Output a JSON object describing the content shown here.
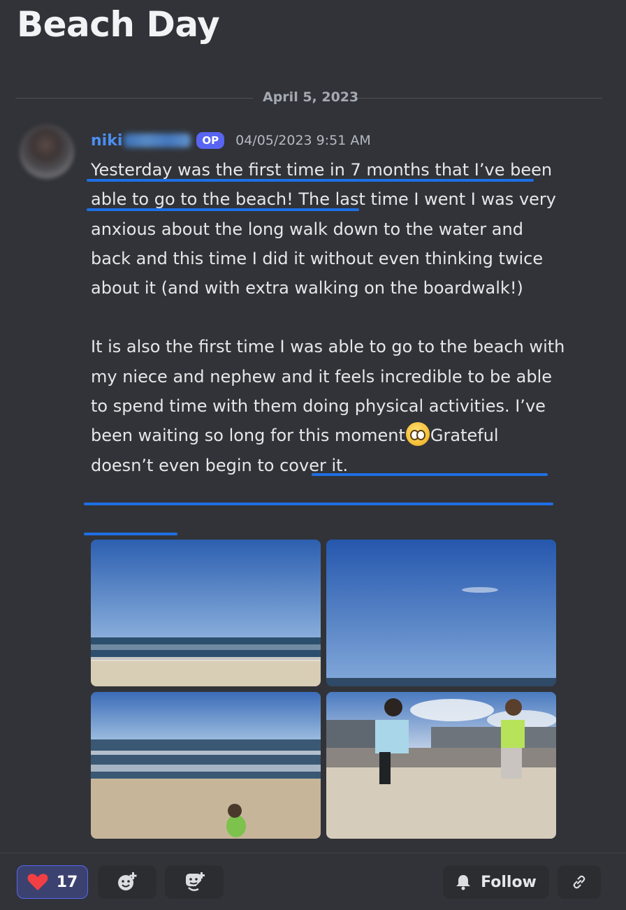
{
  "page_title": "Beach Day",
  "date_divider": "April 5, 2023",
  "post": {
    "author": "niki",
    "op_badge": "OP",
    "timestamp": "04/05/2023 9:51 AM",
    "paragraph1": "Yesterday was the first time in 7 months that I’ve been able to go to the beach! The last time I went I was very anxious about the long walk down to the water and back and this time I did it without even thinking twice about it (and with extra walking on the boardwalk!)",
    "paragraph2_before": "It is also the first time I was able to go to the beach with my niece and nephew and it feels incredible to be able to spend time with them doing physical activities. I’ve been waiting so long for this moment",
    "paragraph2_emoji": "pleading-face-emoji",
    "paragraph2_after": "Grateful doesn’t even begin to cover it.",
    "images": [
      {
        "name": "beach-photo-1"
      },
      {
        "name": "beach-photo-2"
      },
      {
        "name": "beach-photo-3"
      },
      {
        "name": "beach-photo-4"
      }
    ]
  },
  "footer": {
    "reaction_icon": "heart-icon",
    "reaction_count": "17",
    "add_reaction_icon": "add-reaction-icon",
    "sticker_icon": "add-sticker-icon",
    "follow_label": "Follow",
    "follow_icon": "bell-icon",
    "link_icon": "link-icon"
  },
  "colors": {
    "background": "#313338",
    "username": "#4b8ef0",
    "op_badge": "#5865f2",
    "underline": "#1f6fe5",
    "reaction_bg": "#3c4270",
    "heart": "#f23f43"
  }
}
